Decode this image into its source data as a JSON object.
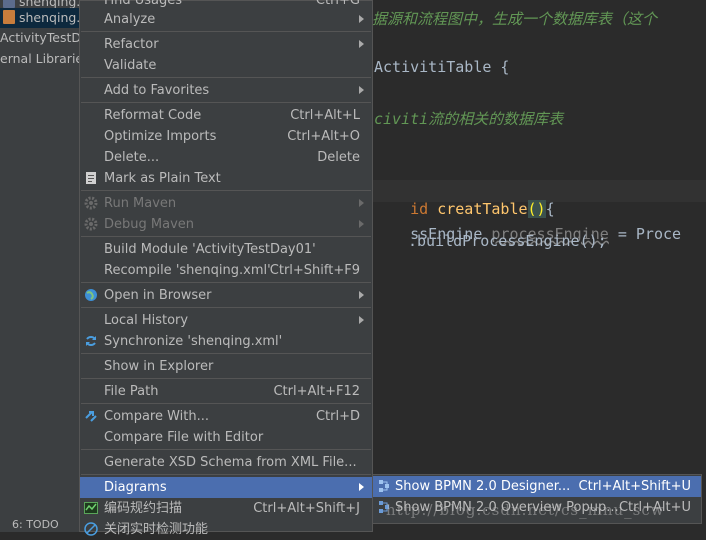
{
  "project_panel": {
    "items": [
      {
        "label": "shenqing.p"
      },
      {
        "label": "shenqing.x"
      },
      {
        "label": "ActivityTestDa"
      },
      {
        "label": "ernal Libraries"
      }
    ],
    "bottom_tab": "6: TODO"
  },
  "editor": {
    "comment1": "据源和流程图中，生成一个数据库表（这个",
    "class_line": "ActivitiTable {",
    "comment2": "civiti流的相关的数据库表",
    "method_kw": "id ",
    "method_name": "creatTable",
    "method_parens": "()",
    "method_brace": "{",
    "line_engine_a": "ssEngine ",
    "line_engine_b": "processEngine",
    "line_engine_c": " = Proce",
    "line_build": ".buildProcessEngine();"
  },
  "context_menu": {
    "items": [
      {
        "label": "Find Usages",
        "shortcut": "Ctrl+G"
      },
      {
        "label": "Analyze",
        "has_submenu": true
      },
      {
        "label": "Refactor",
        "has_submenu": true
      },
      {
        "label": "Validate"
      },
      {
        "label": "Add to Favorites",
        "has_submenu": true
      },
      {
        "label": "Reformat Code",
        "shortcut": "Ctrl+Alt+L"
      },
      {
        "label": "Optimize Imports",
        "shortcut": "Ctrl+Alt+O"
      },
      {
        "label": "Delete...",
        "shortcut": "Delete"
      },
      {
        "label": "Mark as Plain Text"
      },
      {
        "label": "Run Maven",
        "has_submenu": true,
        "disabled": true
      },
      {
        "label": "Debug Maven",
        "has_submenu": true,
        "disabled": true
      },
      {
        "label": "Build Module 'ActivityTestDay01'"
      },
      {
        "label": "Recompile 'shenqing.xml'",
        "shortcut": "Ctrl+Shift+F9"
      },
      {
        "label": "Open in Browser",
        "has_submenu": true
      },
      {
        "label": "Local History",
        "has_submenu": true
      },
      {
        "label": "Synchronize 'shenqing.xml'"
      },
      {
        "label": "Show in Explorer"
      },
      {
        "label": "File Path",
        "shortcut": "Ctrl+Alt+F12"
      },
      {
        "label": "Compare With...",
        "shortcut": "Ctrl+D"
      },
      {
        "label": "Compare File with Editor"
      },
      {
        "label": "Generate XSD Schema from XML File..."
      },
      {
        "label": "Diagrams",
        "has_submenu": true,
        "active": true
      },
      {
        "label": "编码规约扫描",
        "shortcut": "Ctrl+Alt+Shift+J"
      },
      {
        "label": "关闭实时检测功能"
      }
    ]
  },
  "submenu": {
    "items": [
      {
        "label": "Show BPMN 2.0 Designer...",
        "shortcut": "Ctrl+Alt+Shift+U",
        "active": true
      },
      {
        "label": "Show BPMN 2.0 Overview Popup...",
        "shortcut": "Ctrl+Alt+U"
      }
    ]
  },
  "watermark": "http://blog.csdn.net/cs_mnu_scw",
  "colors": {
    "menu_bg": "#3c3f41",
    "highlight": "#4b6eaf",
    "editor_bg": "#2b2b2b",
    "comment": "#629755",
    "keyword": "#cc7832",
    "function": "#ffc66d"
  }
}
